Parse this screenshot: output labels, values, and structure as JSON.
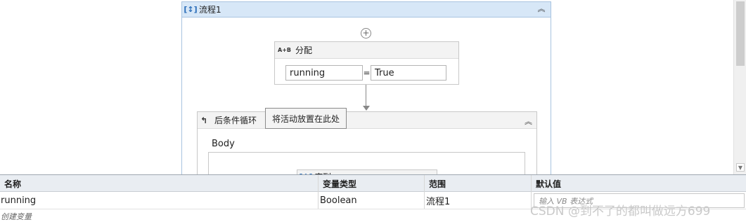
{
  "sequence": {
    "title": "流程1",
    "icon": "sequence-icon"
  },
  "assign": {
    "icon_text": "A+B",
    "title": "分配",
    "left_value": "running",
    "equals": "=",
    "right_value": "True"
  },
  "do_while": {
    "title": "后条件循环",
    "body_label": "Body",
    "inner_activity": "序列"
  },
  "drop_tooltip": "将活动放置在此处",
  "variables": {
    "columns": {
      "name": "名称",
      "type": "变量类型",
      "scope": "范围",
      "default": "默认值"
    },
    "rows": [
      {
        "name": "running",
        "type": "Boolean",
        "scope": "流程1"
      }
    ],
    "default_placeholder": "输入 VB 表达式",
    "create_label": "创建变量"
  },
  "watermark": "CSDN @到不了的都叫做远方699"
}
